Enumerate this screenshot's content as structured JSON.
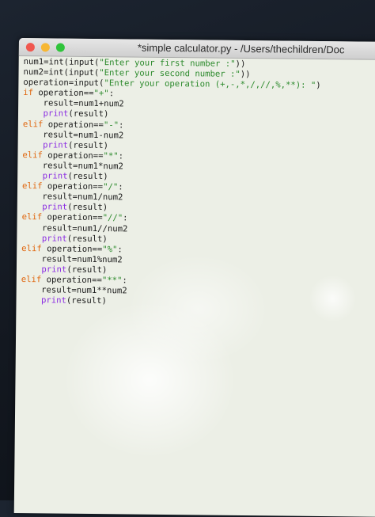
{
  "window": {
    "title": "*simple calculator.py - /Users/thechildren/Doc"
  },
  "code": {
    "lines": [
      {
        "indent": "",
        "segments": [
          {
            "t": "num1=",
            "c": "plain"
          },
          {
            "t": "int",
            "c": "plain"
          },
          {
            "t": "(",
            "c": "plain"
          },
          {
            "t": "input",
            "c": "plain"
          },
          {
            "t": "(",
            "c": "plain"
          },
          {
            "t": "\"Enter your first number :\"",
            "c": "str"
          },
          {
            "t": "))",
            "c": "plain"
          }
        ]
      },
      {
        "indent": "",
        "segments": [
          {
            "t": "num2=",
            "c": "plain"
          },
          {
            "t": "int",
            "c": "plain"
          },
          {
            "t": "(",
            "c": "plain"
          },
          {
            "t": "input",
            "c": "plain"
          },
          {
            "t": "(",
            "c": "plain"
          },
          {
            "t": "\"Enter your second number :\"",
            "c": "str"
          },
          {
            "t": "))",
            "c": "plain"
          }
        ]
      },
      {
        "indent": "",
        "segments": [
          {
            "t": "operation=",
            "c": "plain"
          },
          {
            "t": "input",
            "c": "plain"
          },
          {
            "t": "(",
            "c": "plain"
          },
          {
            "t": "\"Enter your operation (+,-,*,/,//,%,**): \"",
            "c": "str"
          },
          {
            "t": ")",
            "c": "plain"
          }
        ]
      },
      {
        "indent": "",
        "segments": [
          {
            "t": "if",
            "c": "kw"
          },
          {
            "t": " operation==",
            "c": "plain"
          },
          {
            "t": "\"+\"",
            "c": "str"
          },
          {
            "t": ":",
            "c": "plain"
          }
        ]
      },
      {
        "indent": "    ",
        "segments": [
          {
            "t": "result=num1+num2",
            "c": "plain"
          }
        ]
      },
      {
        "indent": "    ",
        "segments": [
          {
            "t": "print",
            "c": "bi"
          },
          {
            "t": "(result)",
            "c": "plain"
          }
        ]
      },
      {
        "indent": "",
        "segments": [
          {
            "t": "elif",
            "c": "kw"
          },
          {
            "t": " operation==",
            "c": "plain"
          },
          {
            "t": "\"-\"",
            "c": "str"
          },
          {
            "t": ":",
            "c": "plain"
          }
        ]
      },
      {
        "indent": "    ",
        "segments": [
          {
            "t": "result=num1-num2",
            "c": "plain"
          }
        ]
      },
      {
        "indent": "    ",
        "segments": [
          {
            "t": "print",
            "c": "bi"
          },
          {
            "t": "(result)",
            "c": "plain"
          }
        ]
      },
      {
        "indent": "",
        "segments": [
          {
            "t": "elif",
            "c": "kw"
          },
          {
            "t": " operation==",
            "c": "plain"
          },
          {
            "t": "\"*\"",
            "c": "str"
          },
          {
            "t": ":",
            "c": "plain"
          }
        ]
      },
      {
        "indent": "    ",
        "segments": [
          {
            "t": "result=num1*num2",
            "c": "plain"
          }
        ]
      },
      {
        "indent": "    ",
        "segments": [
          {
            "t": "print",
            "c": "bi"
          },
          {
            "t": "(result)",
            "c": "plain"
          }
        ]
      },
      {
        "indent": "",
        "segments": [
          {
            "t": "elif",
            "c": "kw"
          },
          {
            "t": " operation==",
            "c": "plain"
          },
          {
            "t": "\"/\"",
            "c": "str"
          },
          {
            "t": ":",
            "c": "plain"
          }
        ]
      },
      {
        "indent": "    ",
        "segments": [
          {
            "t": "result=num1/num2",
            "c": "plain"
          }
        ]
      },
      {
        "indent": "    ",
        "segments": [
          {
            "t": "print",
            "c": "bi"
          },
          {
            "t": "(result)",
            "c": "plain"
          }
        ]
      },
      {
        "indent": "",
        "segments": [
          {
            "t": "elif",
            "c": "kw"
          },
          {
            "t": " operation==",
            "c": "plain"
          },
          {
            "t": "\"//\"",
            "c": "str"
          },
          {
            "t": ":",
            "c": "plain"
          }
        ]
      },
      {
        "indent": "    ",
        "segments": [
          {
            "t": "result=num1//num2",
            "c": "plain"
          }
        ]
      },
      {
        "indent": "    ",
        "segments": [
          {
            "t": "print",
            "c": "bi"
          },
          {
            "t": "(result)",
            "c": "plain"
          }
        ]
      },
      {
        "indent": "",
        "segments": [
          {
            "t": "elif",
            "c": "kw"
          },
          {
            "t": " operation==",
            "c": "plain"
          },
          {
            "t": "\"%\"",
            "c": "str"
          },
          {
            "t": ":",
            "c": "plain"
          }
        ]
      },
      {
        "indent": "    ",
        "segments": [
          {
            "t": "result=num1%num2",
            "c": "plain"
          }
        ]
      },
      {
        "indent": "    ",
        "segments": [
          {
            "t": "print",
            "c": "bi"
          },
          {
            "t": "(result)",
            "c": "plain"
          }
        ]
      },
      {
        "indent": "",
        "segments": [
          {
            "t": "elif",
            "c": "kw"
          },
          {
            "t": " operation==",
            "c": "plain"
          },
          {
            "t": "\"**\"",
            "c": "str"
          },
          {
            "t": ":",
            "c": "plain"
          }
        ]
      },
      {
        "indent": "    ",
        "segments": [
          {
            "t": "result=num1**num2",
            "c": "plain"
          }
        ]
      },
      {
        "indent": "    ",
        "segments": [
          {
            "t": "print",
            "c": "bi"
          },
          {
            "t": "(result)",
            "c": "plain"
          }
        ]
      }
    ]
  },
  "colors": {
    "keyword": "#e0660e",
    "builtin": "#8a2be2",
    "string": "#2c8a2c",
    "plain": "#1b1b1b",
    "editor_bg": "#ecefe6"
  }
}
